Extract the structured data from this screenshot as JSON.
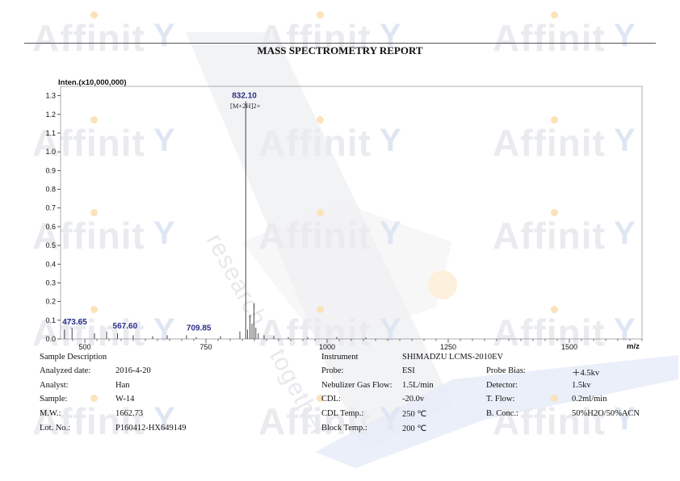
{
  "report": {
    "title": "MASS SPECTROMETRY REPORT"
  },
  "watermark": {
    "word": "Affinit",
    "tag": "research together",
    "diag1": "research",
    "diag2": "together"
  },
  "chart_data": {
    "type": "bar",
    "y_axis_title": "Inten.(x10,000,000)",
    "x_axis_title": "m/z",
    "xlim": [
      450,
      1650
    ],
    "ylim": [
      0,
      1.35
    ],
    "xticks": [
      500,
      750,
      1000,
      1250,
      1500
    ],
    "xtick_labels": [
      "500",
      "750",
      "1000",
      "1250",
      "1500"
    ],
    "yticks": [
      0.0,
      0.1,
      0.2,
      0.3,
      0.4,
      0.5,
      0.6,
      0.7,
      0.8,
      0.9,
      1.0,
      1.1,
      1.2,
      1.3
    ],
    "ytick_labels": [
      "0.0",
      "0.1",
      "0.2",
      "0.3",
      "0.4",
      "0.5",
      "0.6",
      "0.7",
      "0.8",
      "0.9",
      "1.0",
      "1.1",
      "1.2",
      "1.3"
    ],
    "peaks": [
      {
        "x": 458,
        "y": 0.05
      },
      {
        "x": 473.65,
        "y": 0.06
      },
      {
        "x": 520,
        "y": 0.03
      },
      {
        "x": 545,
        "y": 0.04
      },
      {
        "x": 567.6,
        "y": 0.03
      },
      {
        "x": 600,
        "y": 0.02
      },
      {
        "x": 640,
        "y": 0.015
      },
      {
        "x": 670,
        "y": 0.02
      },
      {
        "x": 709.85,
        "y": 0.02
      },
      {
        "x": 730,
        "y": 0.01
      },
      {
        "x": 780,
        "y": 0.015
      },
      {
        "x": 820,
        "y": 0.04
      },
      {
        "x": 832.1,
        "y": 1.27
      },
      {
        "x": 836,
        "y": 0.05
      },
      {
        "x": 841,
        "y": 0.13
      },
      {
        "x": 845,
        "y": 0.08
      },
      {
        "x": 849,
        "y": 0.19
      },
      {
        "x": 853,
        "y": 0.06
      },
      {
        "x": 858,
        "y": 0.03
      },
      {
        "x": 870,
        "y": 0.02
      },
      {
        "x": 890,
        "y": 0.015
      },
      {
        "x": 920,
        "y": 0.01
      },
      {
        "x": 960,
        "y": 0.01
      },
      {
        "x": 1020,
        "y": 0.01
      },
      {
        "x": 1080,
        "y": 0.008
      }
    ],
    "peak_labels": [
      {
        "text": "832.10",
        "x": 832.1,
        "y": 1.27
      },
      {
        "text": "473.65",
        "x": 473.65,
        "y": 0.06
      },
      {
        "text": "567.60",
        "x": 567.6,
        "y": 0.03
      },
      {
        "text": "709.85",
        "x": 709.85,
        "y": 0.02
      }
    ],
    "annotation": {
      "text": "[M+2H]2+",
      "x": 832.1,
      "y": 1.27
    }
  },
  "sample": {
    "heading": "Sample Description",
    "rows": [
      {
        "label": "Analyzed date:",
        "value": "2016-4-20"
      },
      {
        "label": "Analyst:",
        "value": "Han"
      },
      {
        "label": "Sample:",
        "value": "W-14"
      },
      {
        "label": "M.W.:",
        "value": "1662.73"
      },
      {
        "label": "Lot. No.:",
        "value": "P160412-HX649149"
      }
    ]
  },
  "instrument": {
    "label": "Instrument",
    "name": "SHIMADZU LCMS-2010EV",
    "left_rows": [
      {
        "label": "Probe:",
        "value": "ESI"
      },
      {
        "label": "Nebulizer Gas Flow:",
        "value": "1.5L/min"
      },
      {
        "label": "CDL:",
        "value": "-20.0v"
      },
      {
        "label": "CDL Temp.:",
        "value": "250 ℃"
      },
      {
        "label": "Block Temp.:",
        "value": "200 ℃"
      }
    ],
    "right_rows": [
      {
        "label": "Probe Bias:",
        "value": "＋4.5kv"
      },
      {
        "label": "Detector:",
        "value": "1.5kv"
      },
      {
        "label": "T. Flow:",
        "value": "0.2ml/min"
      },
      {
        "label": "B. Conc.:",
        "value": "50%H2O/50%ACN"
      }
    ]
  }
}
